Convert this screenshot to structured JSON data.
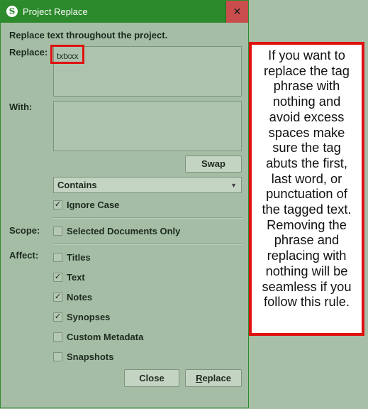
{
  "window": {
    "title": "Project Replace",
    "app_icon": "S",
    "close_label": "✕"
  },
  "heading": "Replace text throughout the project.",
  "replace": {
    "label": "Replace:",
    "value": "txtxxx"
  },
  "with": {
    "label": "With:",
    "value": ""
  },
  "swap_label": "Swap",
  "match_mode": {
    "selected": "Contains"
  },
  "ignore_case": {
    "label": "Ignore Case",
    "checked": true
  },
  "scope": {
    "label": "Scope:",
    "option_label": "Selected Documents Only",
    "checked": false
  },
  "affect": {
    "label": "Affect:",
    "items": [
      {
        "label": "Titles",
        "checked": false
      },
      {
        "label": "Text",
        "checked": true
      },
      {
        "label": "Notes",
        "checked": true
      },
      {
        "label": "Synopses",
        "checked": true
      },
      {
        "label": "Custom Metadata",
        "checked": false
      },
      {
        "label": "Snapshots",
        "checked": false
      }
    ]
  },
  "buttons": {
    "close": "Close",
    "replace_prefix": "R",
    "replace_rest": "eplace"
  },
  "callout": "If you want to replace the tag phrase with nothing and avoid excess spaces make sure the tag abuts the first, last word, or punctuation of the tagged text. Removing the phrase and replacing with nothing will be seamless if you follow this rule.",
  "colors": {
    "titlebar": "#2c8a2c",
    "dialog_bg": "#a5bda5",
    "close_button": "#c94d4d",
    "annotation_red": "#e01010"
  }
}
